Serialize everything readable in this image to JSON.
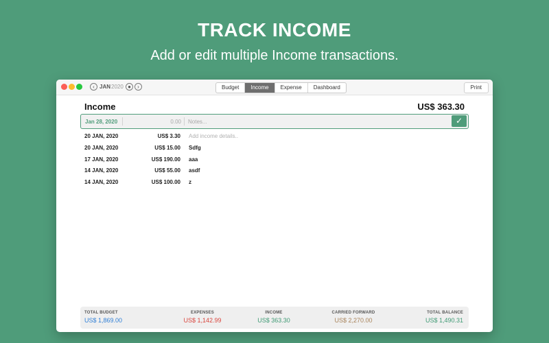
{
  "hero": {
    "title": "TRACK INCOME",
    "subtitle": "Add or edit multiple Income transactions."
  },
  "toolbar": {
    "prev_icon": "chevron-left-icon",
    "month": "JAN",
    "year": "2020",
    "today_icon": "record-icon",
    "next_icon": "chevron-right-icon",
    "tabs": [
      {
        "label": "Budget",
        "active": false
      },
      {
        "label": "Income",
        "active": true
      },
      {
        "label": "Expense",
        "active": false
      },
      {
        "label": "Dashboard",
        "active": false
      }
    ],
    "print_label": "Print"
  },
  "income": {
    "title": "Income",
    "total": "US$ 363.30",
    "entry": {
      "date": "Jan 28, 2020",
      "amount_placeholder": "0.00",
      "notes_placeholder": "Notes...",
      "confirm_icon": "checkmark-icon"
    },
    "transactions": [
      {
        "date": "20 JAN, 2020",
        "amount": "US$ 3.30",
        "note": "Add income details..",
        "placeholder": true
      },
      {
        "date": "20 JAN, 2020",
        "amount": "US$ 15.00",
        "note": "Sdfg",
        "placeholder": false
      },
      {
        "date": "17 JAN, 2020",
        "amount": "US$ 190.00",
        "note": "aaa",
        "placeholder": false
      },
      {
        "date": "14 JAN, 2020",
        "amount": "US$ 55.00",
        "note": "asdf",
        "placeholder": false
      },
      {
        "date": "14 JAN, 2020",
        "amount": "US$ 100.00",
        "note": "z",
        "placeholder": false
      }
    ]
  },
  "summary": {
    "total_budget": {
      "label": "TOTAL BUDGET",
      "value": "US$ 1,869.00",
      "color": "#2f7fd6"
    },
    "expenses": {
      "label": "EXPENSES",
      "value": "US$ 1,142.99",
      "color": "#d9453d"
    },
    "income": {
      "label": "INCOME",
      "value": "US$ 363.30",
      "color": "#3f9a74"
    },
    "carried_forward": {
      "label": "CARRIED FORWARD",
      "value": "US$ 2,270.00",
      "color": "#a8835a"
    },
    "total_balance": {
      "label": "TOTAL BALANCE",
      "value": "US$ 1,490.31",
      "color": "#3f9a74"
    }
  },
  "colors": {
    "background": "#4f9c7a",
    "accent": "#4f9c7a"
  }
}
